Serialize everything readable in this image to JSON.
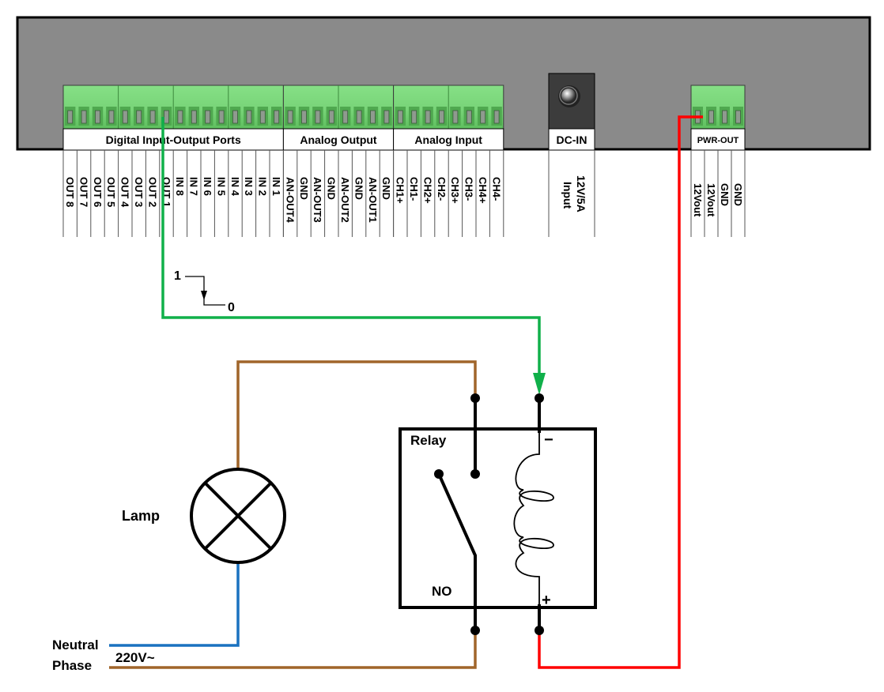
{
  "controller": {
    "groups": [
      {
        "id": "digital",
        "label": "Digital Input-Output Ports",
        "pins": [
          "OUT 8",
          "OUT 7",
          "OUT 6",
          "OUT 5",
          "OUT 4",
          "OUT 3",
          "OUT 2",
          "OUT 1",
          "IN 8",
          "IN 7",
          "IN 6",
          "IN 5",
          "IN 4",
          "IN 3",
          "IN 2",
          "IN 1"
        ]
      },
      {
        "id": "analog-output",
        "label": "Analog Output",
        "pins": [
          "AN-OUT4",
          "GND",
          "AN-OUT3",
          "GND",
          "AN-OUT2",
          "GND",
          "AN-OUT1",
          "GND"
        ]
      },
      {
        "id": "analog-input",
        "label": "Analog Input",
        "pins": [
          "CH1+",
          "CH1-",
          "CH2+",
          "CH2-",
          "CH3+",
          "CH3-",
          "CH4+",
          "CH4-"
        ]
      }
    ],
    "dc_in": {
      "label": "DC-IN",
      "pin_lines": [
        "12V/5A",
        "Input"
      ]
    },
    "pwr_out": {
      "label": "PWR-OUT",
      "pins": [
        "12Vout",
        "12Vout",
        "GND",
        "GND"
      ]
    }
  },
  "signal": {
    "high": "1",
    "low": "0"
  },
  "relay": {
    "label": "Relay",
    "contact": "NO",
    "coil_minus": "−",
    "coil_plus": "+"
  },
  "lamp": {
    "label": "Lamp"
  },
  "mains": {
    "neutral": "Neutral",
    "phase": "Phase",
    "voltage": "220V~"
  },
  "colors": {
    "panel": "#8a8a8a",
    "terminal": "#7fdc7f",
    "signal_wire": "#10b04a",
    "power_wire": "#ff0000",
    "phase_wire": "#a0652a",
    "neutral_wire": "#1a72c0"
  }
}
